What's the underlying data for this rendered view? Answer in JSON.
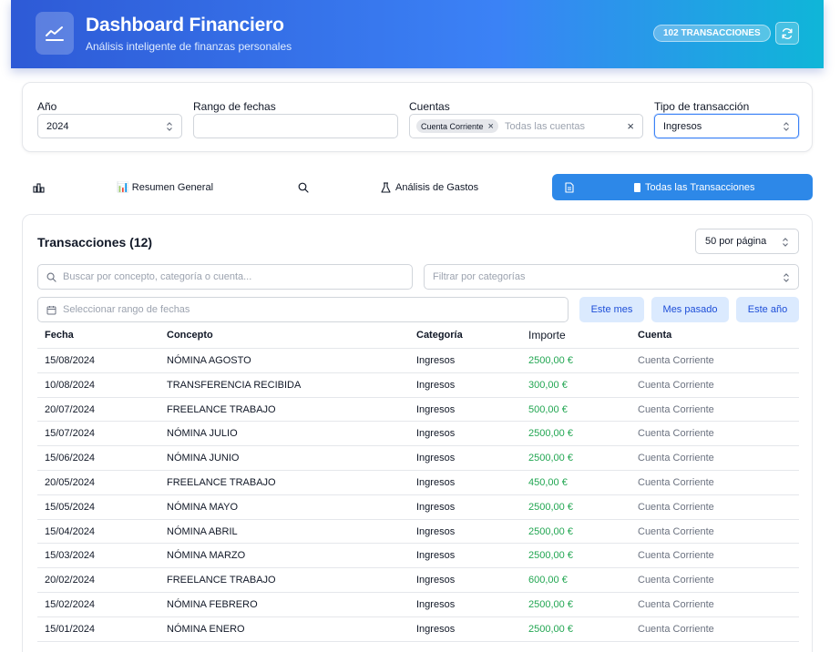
{
  "header": {
    "title": "Dashboard Financiero",
    "subtitle": "Análisis inteligente de finanzas personales",
    "badge": "102 TRANSACCIONES",
    "icons": {
      "logo": "chart-line-icon",
      "refresh": "refresh-icon"
    }
  },
  "filters": {
    "year": {
      "label": "Año",
      "value": "2024"
    },
    "date_range": {
      "label": "Rango de fechas",
      "value": ""
    },
    "accounts": {
      "label": "Cuentas",
      "selected": [
        "Cuenta Corriente"
      ],
      "placeholder": "Todas las cuentas"
    },
    "tx_type": {
      "label": "Tipo de transacción",
      "value": "Ingresos"
    }
  },
  "tabs": [
    {
      "label": "",
      "icon": "bar-chart-icon"
    },
    {
      "label": "📊 Resumen General",
      "icon": ""
    },
    {
      "label": "",
      "icon": "search-icon"
    },
    {
      "label": "Análisis de Gastos",
      "icon": "flask-icon"
    },
    {
      "label": "",
      "icon": "document-icon"
    },
    {
      "label": "Todas las Transacciones",
      "icon": "notebook-icon",
      "active": true
    }
  ],
  "transactions": {
    "title": "Transacciones (12)",
    "per_page": "50 por página",
    "search_placeholder": "Buscar por concepto, categoría o cuenta...",
    "category_placeholder": "Filtrar por categorías",
    "date_placeholder": "Seleccionar rango de fechas",
    "quick_buttons": [
      "Este mes",
      "Mes pasado",
      "Este año"
    ],
    "columns": [
      "Fecha",
      "Concepto",
      "Categoría",
      "Importe",
      "Cuenta"
    ],
    "rows": [
      [
        "15/08/2024",
        "NÓMINA AGOSTO",
        "Ingresos",
        "2500,00 €",
        "Cuenta Corriente"
      ],
      [
        "10/08/2024",
        "TRANSFERENCIA RECIBIDA",
        "Ingresos",
        "300,00 €",
        "Cuenta Corriente"
      ],
      [
        "20/07/2024",
        "FREELANCE TRABAJO",
        "Ingresos",
        "500,00 €",
        "Cuenta Corriente"
      ],
      [
        "15/07/2024",
        "NÓMINA JULIO",
        "Ingresos",
        "2500,00 €",
        "Cuenta Corriente"
      ],
      [
        "15/06/2024",
        "NÓMINA JUNIO",
        "Ingresos",
        "2500,00 €",
        "Cuenta Corriente"
      ],
      [
        "20/05/2024",
        "FREELANCE TRABAJO",
        "Ingresos",
        "450,00 €",
        "Cuenta Corriente"
      ],
      [
        "15/05/2024",
        "NÓMINA MAYO",
        "Ingresos",
        "2500,00 €",
        "Cuenta Corriente"
      ],
      [
        "15/04/2024",
        "NÓMINA ABRIL",
        "Ingresos",
        "2500,00 €",
        "Cuenta Corriente"
      ],
      [
        "15/03/2024",
        "NÓMINA MARZO",
        "Ingresos",
        "2500,00 €",
        "Cuenta Corriente"
      ],
      [
        "20/02/2024",
        "FREELANCE TRABAJO",
        "Ingresos",
        "600,00 €",
        "Cuenta Corriente"
      ],
      [
        "15/02/2024",
        "NÓMINA FEBRERO",
        "Ingresos",
        "2500,00 €",
        "Cuenta Corriente"
      ],
      [
        "15/01/2024",
        "NÓMINA ENERO",
        "Ingresos",
        "2500,00 €",
        "Cuenta Corriente"
      ]
    ]
  },
  "colors": {
    "primary": "#2d88e8",
    "header_gradient": [
      "#2e5ad6",
      "#3b82f6",
      "#0fb6d8"
    ],
    "amount_positive": "#22a652",
    "quick_button_bg": "#dbeafe"
  }
}
